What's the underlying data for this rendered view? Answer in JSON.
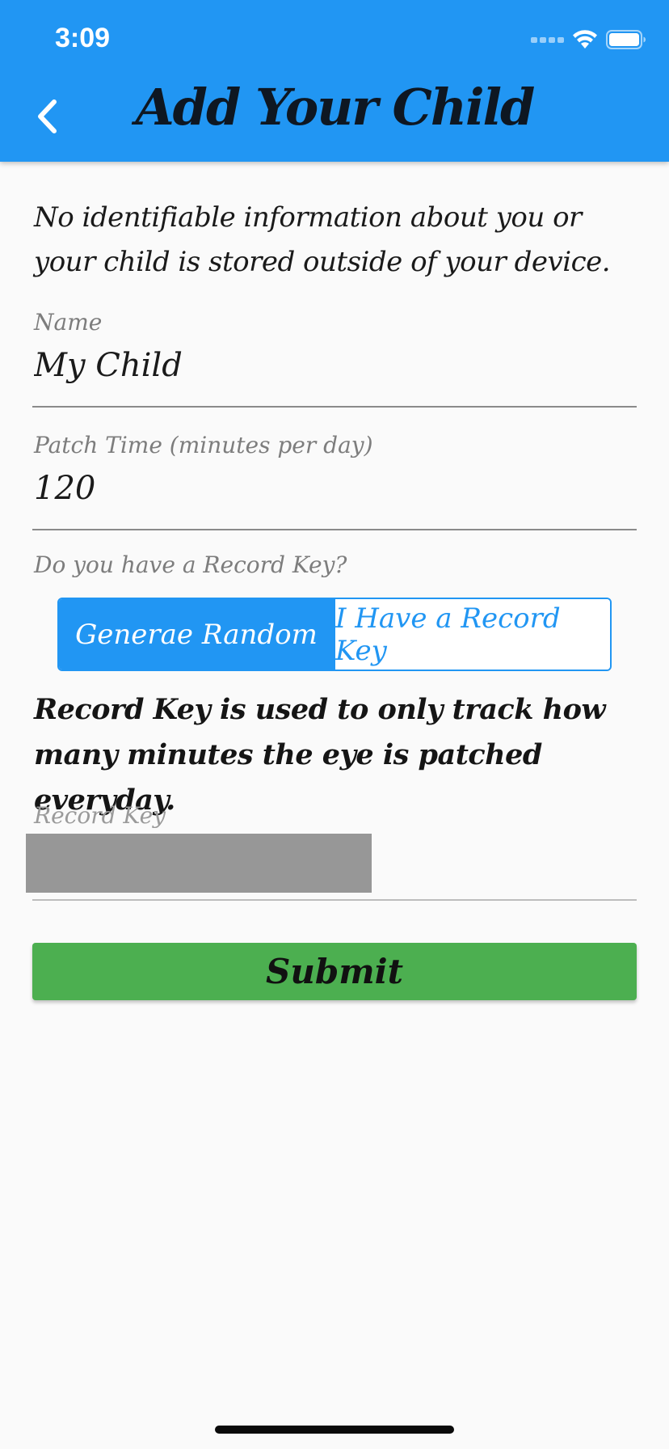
{
  "status_bar": {
    "time": "3:09",
    "icons": [
      "cellular-signal-icon",
      "wifi-icon",
      "battery-icon"
    ]
  },
  "app_bar": {
    "title": "Add Your Child",
    "back_icon": "chevron-left-icon",
    "color": "#2196f3"
  },
  "privacy_note": "No identifiable information about you or your child is stored outside of your device.",
  "form": {
    "name": {
      "label": "Name",
      "value": "My Child"
    },
    "patch_time": {
      "label": "Patch Time (minutes per day)",
      "value": "120"
    },
    "record_key_question": "Do you have a Record Key?",
    "record_key_options": [
      {
        "label": "Generae Random",
        "selected": true
      },
      {
        "label": "I Have a Record Key",
        "selected": false
      }
    ],
    "record_key_note": "Record Key is used to only track how many minutes the eye is patched everyday.",
    "record_key": {
      "label": "Record Key"
    },
    "submit_label": "Submit"
  },
  "colors": {
    "primary": "#2196f3",
    "submit": "#4caf50",
    "background": "#fafafa",
    "redaction": "#979797"
  }
}
